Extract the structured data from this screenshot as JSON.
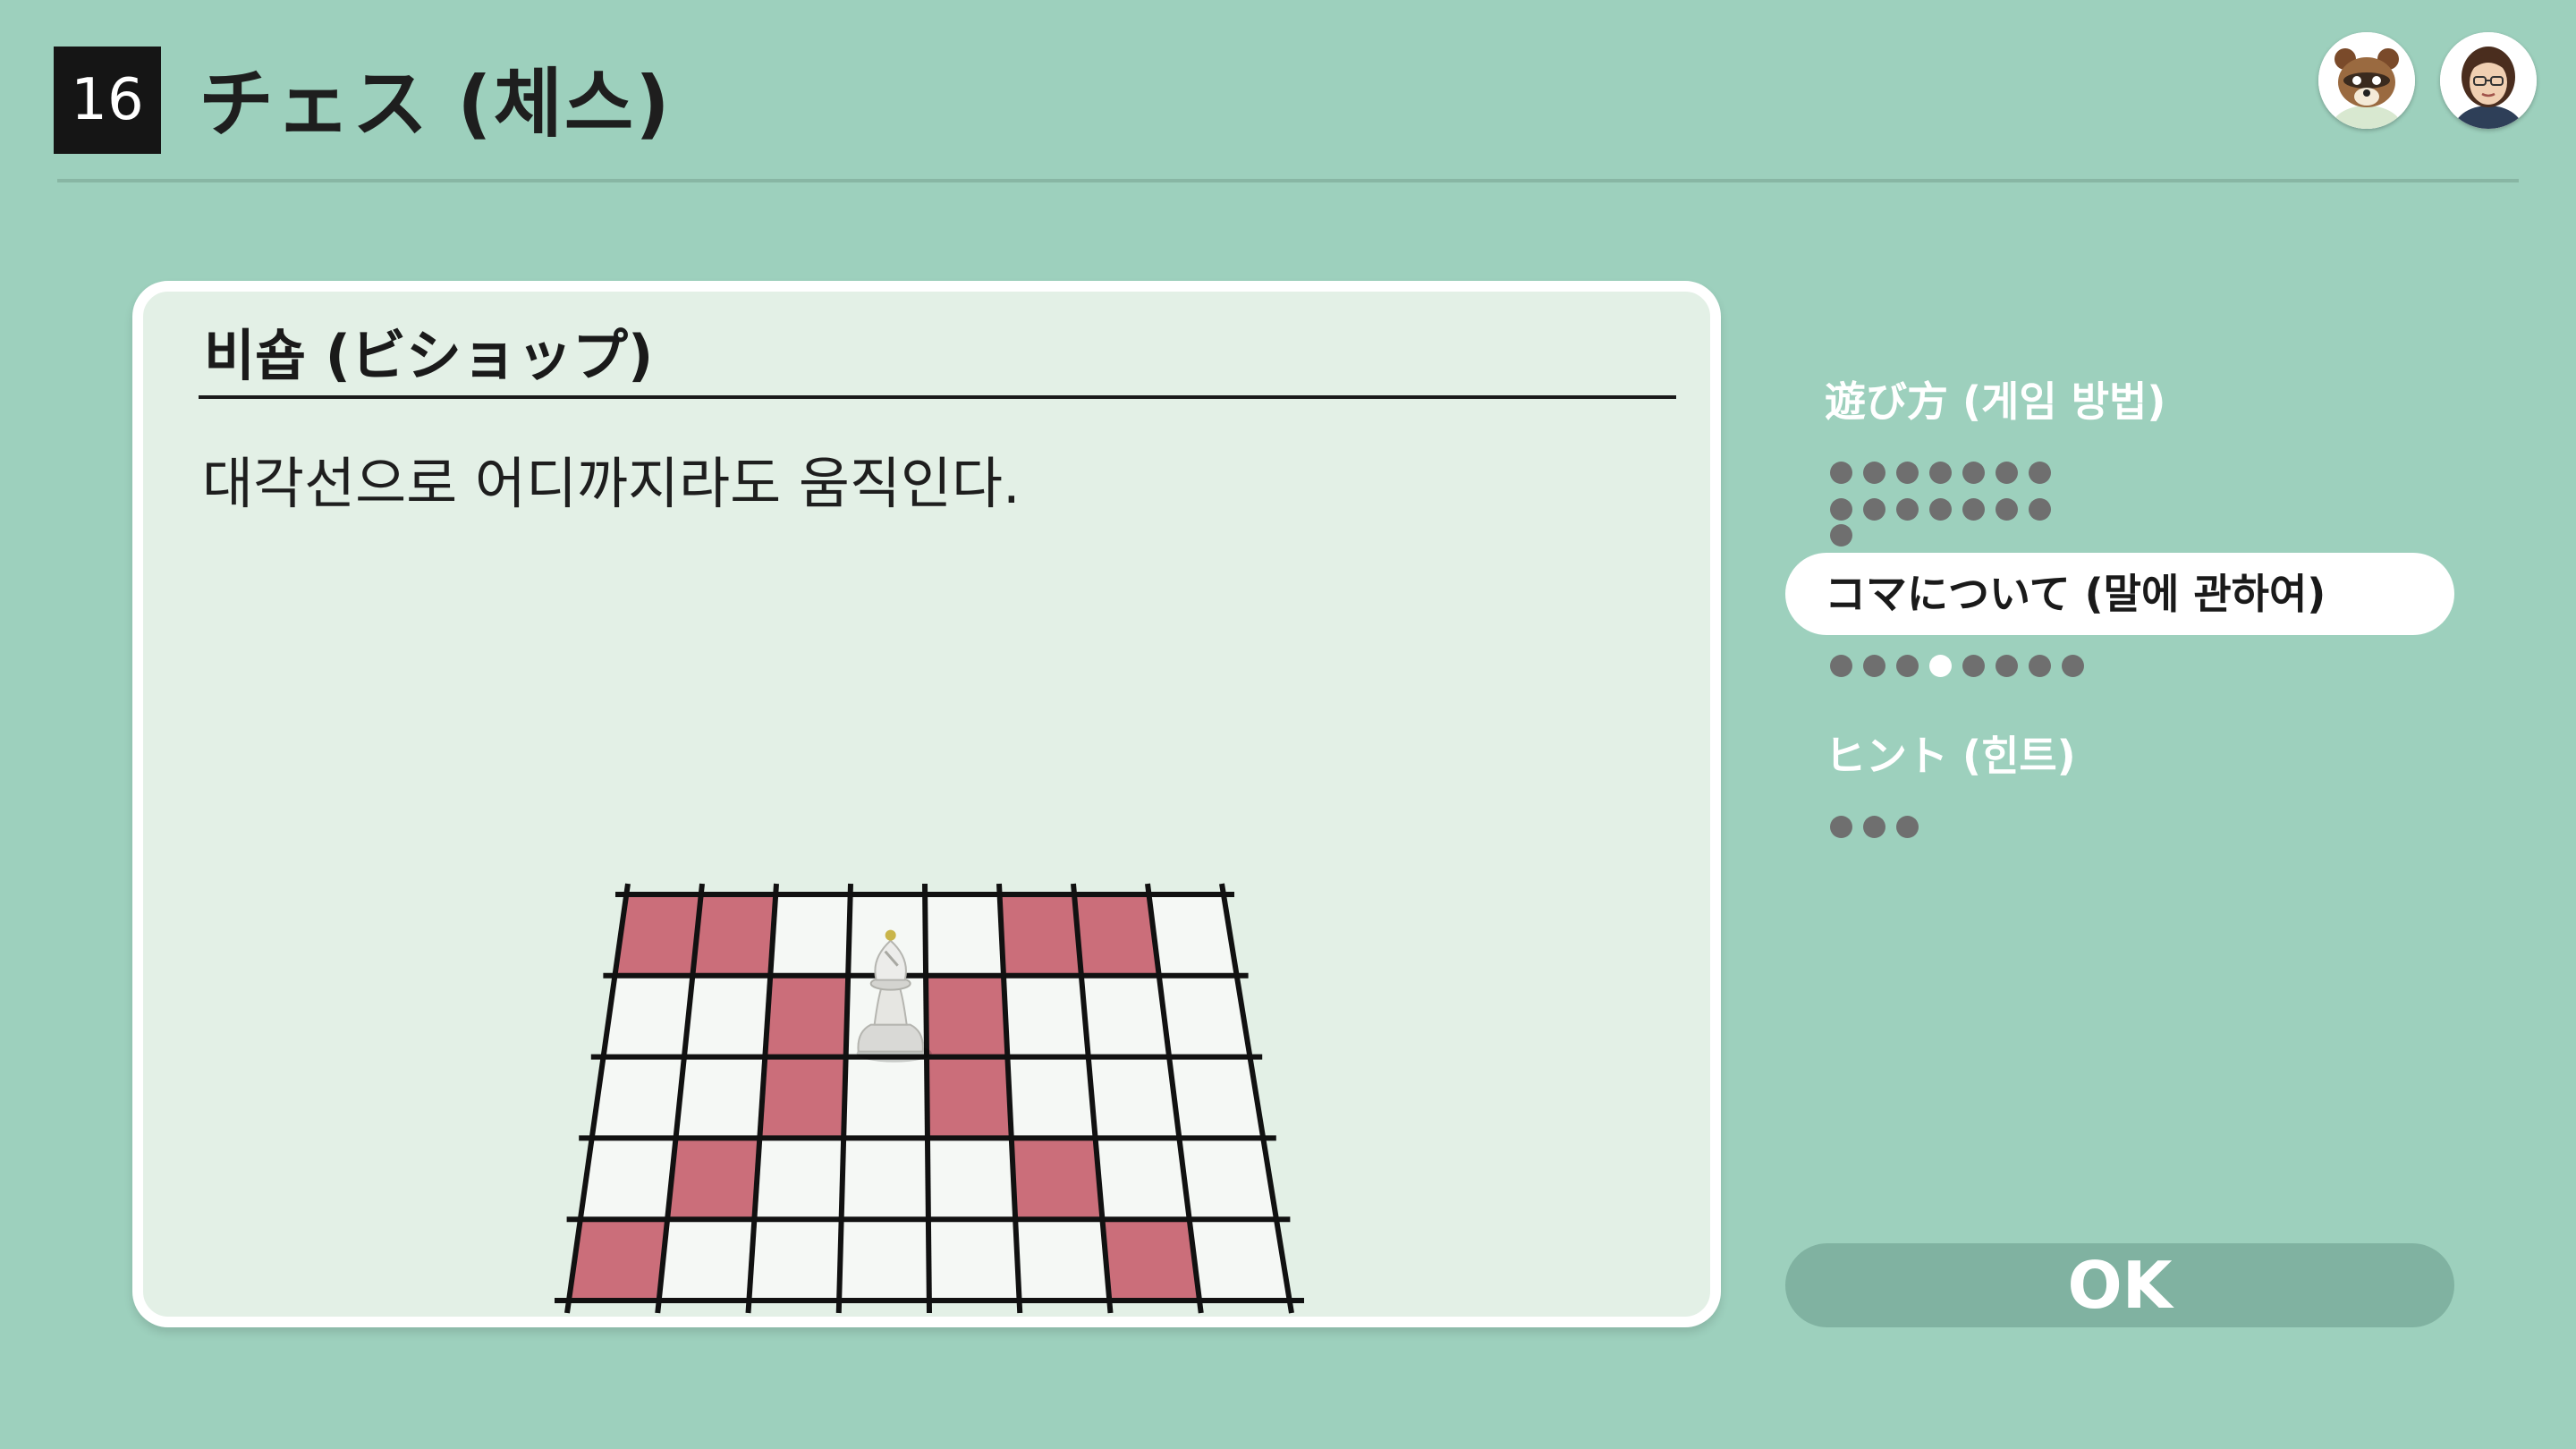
{
  "header": {
    "game_number": "16",
    "title": "チェス (체스)"
  },
  "avatars": [
    {
      "name": "raccoon-character-avatar"
    },
    {
      "name": "user-mii-avatar"
    }
  ],
  "piece_panel": {
    "title": "비숍 (ビショップ)",
    "description": "대각선으로 어디까지라도 움직인다.",
    "board": {
      "columns": 8,
      "rows": 5,
      "bishop_position": {
        "col": 3,
        "row": 1
      },
      "highlighted_squares": [
        [
          1,
          0
        ],
        [
          5,
          0
        ],
        [
          0,
          0
        ],
        [
          6,
          0
        ],
        [
          2,
          1
        ],
        [
          4,
          1
        ],
        [
          2,
          2
        ],
        [
          4,
          2
        ],
        [
          1,
          3
        ],
        [
          5,
          3
        ],
        [
          0,
          4
        ],
        [
          6,
          4
        ]
      ],
      "colors": {
        "light": "#f5f8f5",
        "highlight": "#cb6e7a",
        "lines": "#111111"
      }
    }
  },
  "sidebar": {
    "sections": [
      {
        "label": "遊び方 (게임 방법)",
        "pages": 15,
        "active_page": null,
        "selected": false
      },
      {
        "label": "コマについて (말에 관하여)",
        "pages": 8,
        "active_page": 4,
        "selected": true
      },
      {
        "label": "ヒント (힌트)",
        "pages": 3,
        "active_page": null,
        "selected": false
      }
    ],
    "ok_label": "OK"
  },
  "colors": {
    "background": "#9dd0bd",
    "panel": "#e3f0e6",
    "ok_button": "#80b2a1",
    "page_dot": "#6f6f6f",
    "page_dot_active": "#ffffff"
  }
}
